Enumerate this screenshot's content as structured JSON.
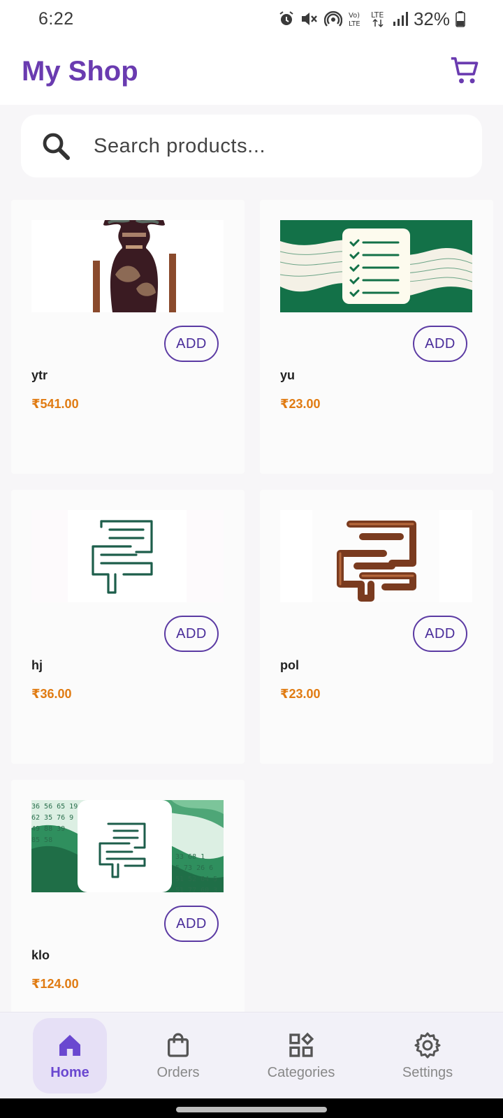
{
  "status_bar": {
    "time": "6:22",
    "battery": "32%"
  },
  "app_bar": {
    "title": "My Shop",
    "cart_icon": "cart-icon"
  },
  "search": {
    "placeholder": "Search products...",
    "value": ""
  },
  "products": [
    {
      "name": "ytr",
      "price": "₹541.00",
      "add_label": "ADD",
      "image": "vase"
    },
    {
      "name": "yu",
      "price": "₹23.00",
      "add_label": "ADD",
      "image": "checklist"
    },
    {
      "name": "hj",
      "price": "₹36.00",
      "add_label": "ADD",
      "image": "green-logo"
    },
    {
      "name": "pol",
      "price": "₹23.00",
      "add_label": "ADD",
      "image": "wood-logo"
    },
    {
      "name": "klo",
      "price": "₹124.00",
      "add_label": "ADD",
      "image": "green-numbers"
    }
  ],
  "bottom_nav": [
    {
      "label": "Home",
      "icon": "home-icon",
      "active": true
    },
    {
      "label": "Orders",
      "icon": "shopping-bag-icon",
      "active": false
    },
    {
      "label": "Categories",
      "icon": "categories-icon",
      "active": false
    },
    {
      "label": "Settings",
      "icon": "gear-icon",
      "active": false
    }
  ],
  "colors": {
    "brand": "#6a3bb0",
    "price": "#e07b12",
    "button_border": "#5b3aa3",
    "nav_active_bg": "#e6e0f6"
  }
}
